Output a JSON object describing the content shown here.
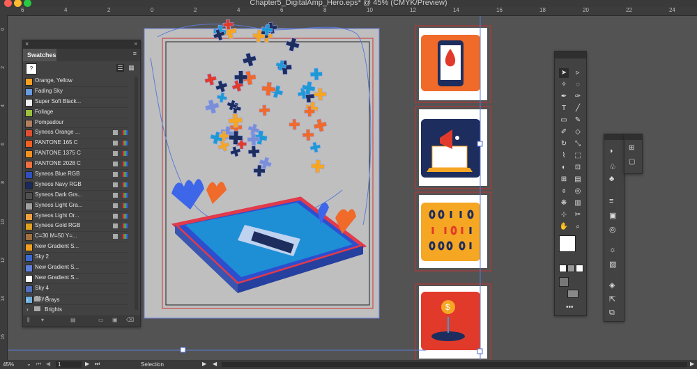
{
  "window": {
    "title": "Chapter5_DigitalAmp_Hero.eps* @ 45% (CMYK/Preview)"
  },
  "rulers": {
    "top_labels": [
      "6",
      "4",
      "2",
      "0",
      "2",
      "4",
      "6",
      "8",
      "10",
      "12",
      "14",
      "16",
      "18",
      "20",
      "22",
      "24"
    ],
    "left_labels": [
      "0",
      "2",
      "4",
      "6",
      "8",
      "10",
      "12",
      "14",
      "16"
    ]
  },
  "swatches": {
    "tab_label": "Swatches",
    "items": [
      {
        "name": "Orange, Yellow",
        "color": "#f4a020"
      },
      {
        "name": "Fading Sky",
        "color": "#6a9ae0"
      },
      {
        "name": "Super Soft Black...",
        "color": "#f0f0f0"
      },
      {
        "name": "Foliage",
        "color": "#9ac040"
      },
      {
        "name": "Pompadour",
        "color": "#b08060"
      },
      {
        "name": "Syneos Orange ...",
        "color": "#e05030"
      },
      {
        "name": "PANTONE 165 C",
        "color": "#f06020"
      },
      {
        "name": "PANTONE 1375 C",
        "color": "#f49020"
      },
      {
        "name": "PANTONE 2028 C",
        "color": "#f07040"
      },
      {
        "name": "Syneos Blue RGB",
        "color": "#3050c0"
      },
      {
        "name": "Syneos Navy RGB",
        "color": "#1a2a5a"
      },
      {
        "name": "Syneos Dark Gra...",
        "color": "#505050"
      },
      {
        "name": "Syneos Light Gra...",
        "color": "#a0a0a0"
      },
      {
        "name": "Syneos Light Or...",
        "color": "#f0a040"
      },
      {
        "name": "Syneos Gold RGB",
        "color": "#e0a020"
      },
      {
        "name": "C=30 M=50 Y=...",
        "color": "#a07040"
      },
      {
        "name": "New Gradient S...",
        "color": "#f0a020"
      },
      {
        "name": "Sky 2",
        "color": "#3a6ad0"
      },
      {
        "name": "New Gradient S...",
        "color": "#6080e0"
      },
      {
        "name": "New Gradient S...",
        "color": "#ffffff"
      },
      {
        "name": "Sky 4",
        "color": "#5070c0"
      },
      {
        "name": "Sky 3",
        "color": "#70b0e0"
      }
    ],
    "groups": [
      "Grays",
      "Brights"
    ]
  },
  "status": {
    "zoom": "45%",
    "artboard": "1",
    "tool": "Selection"
  },
  "colors": {
    "art_orange": "#f06a2a",
    "art_navy": "#1c2d5e",
    "art_gold": "#f5a623",
    "art_red": "#e23a2a"
  }
}
